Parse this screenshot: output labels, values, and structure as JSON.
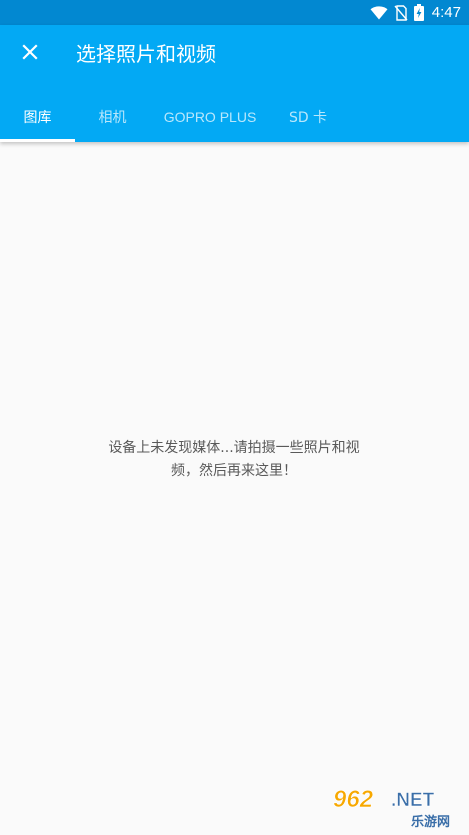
{
  "status_bar": {
    "time": "4:47",
    "icons": [
      "wifi-icon",
      "no-sim-icon",
      "battery-charging-icon"
    ]
  },
  "app_bar": {
    "close_icon": "close-icon",
    "title": "选择照片和视频"
  },
  "tabs": [
    {
      "label": "图库",
      "active": true
    },
    {
      "label": "相机",
      "active": false
    },
    {
      "label": "GOPRO PLUS",
      "active": false
    },
    {
      "label": "SD 卡",
      "active": false
    }
  ],
  "empty_state": {
    "message_line1": "设备上未发现媒体...请拍摄一些照片和视",
    "message_line2": "频，然后再来这里！"
  },
  "watermark": {
    "number": "962",
    "domain": ".NET",
    "cn": "乐游网"
  },
  "colors": {
    "status_bar": "#0288d1",
    "app_bar": "#03a9f4",
    "background": "#fafafa",
    "text_muted": "#595959"
  }
}
